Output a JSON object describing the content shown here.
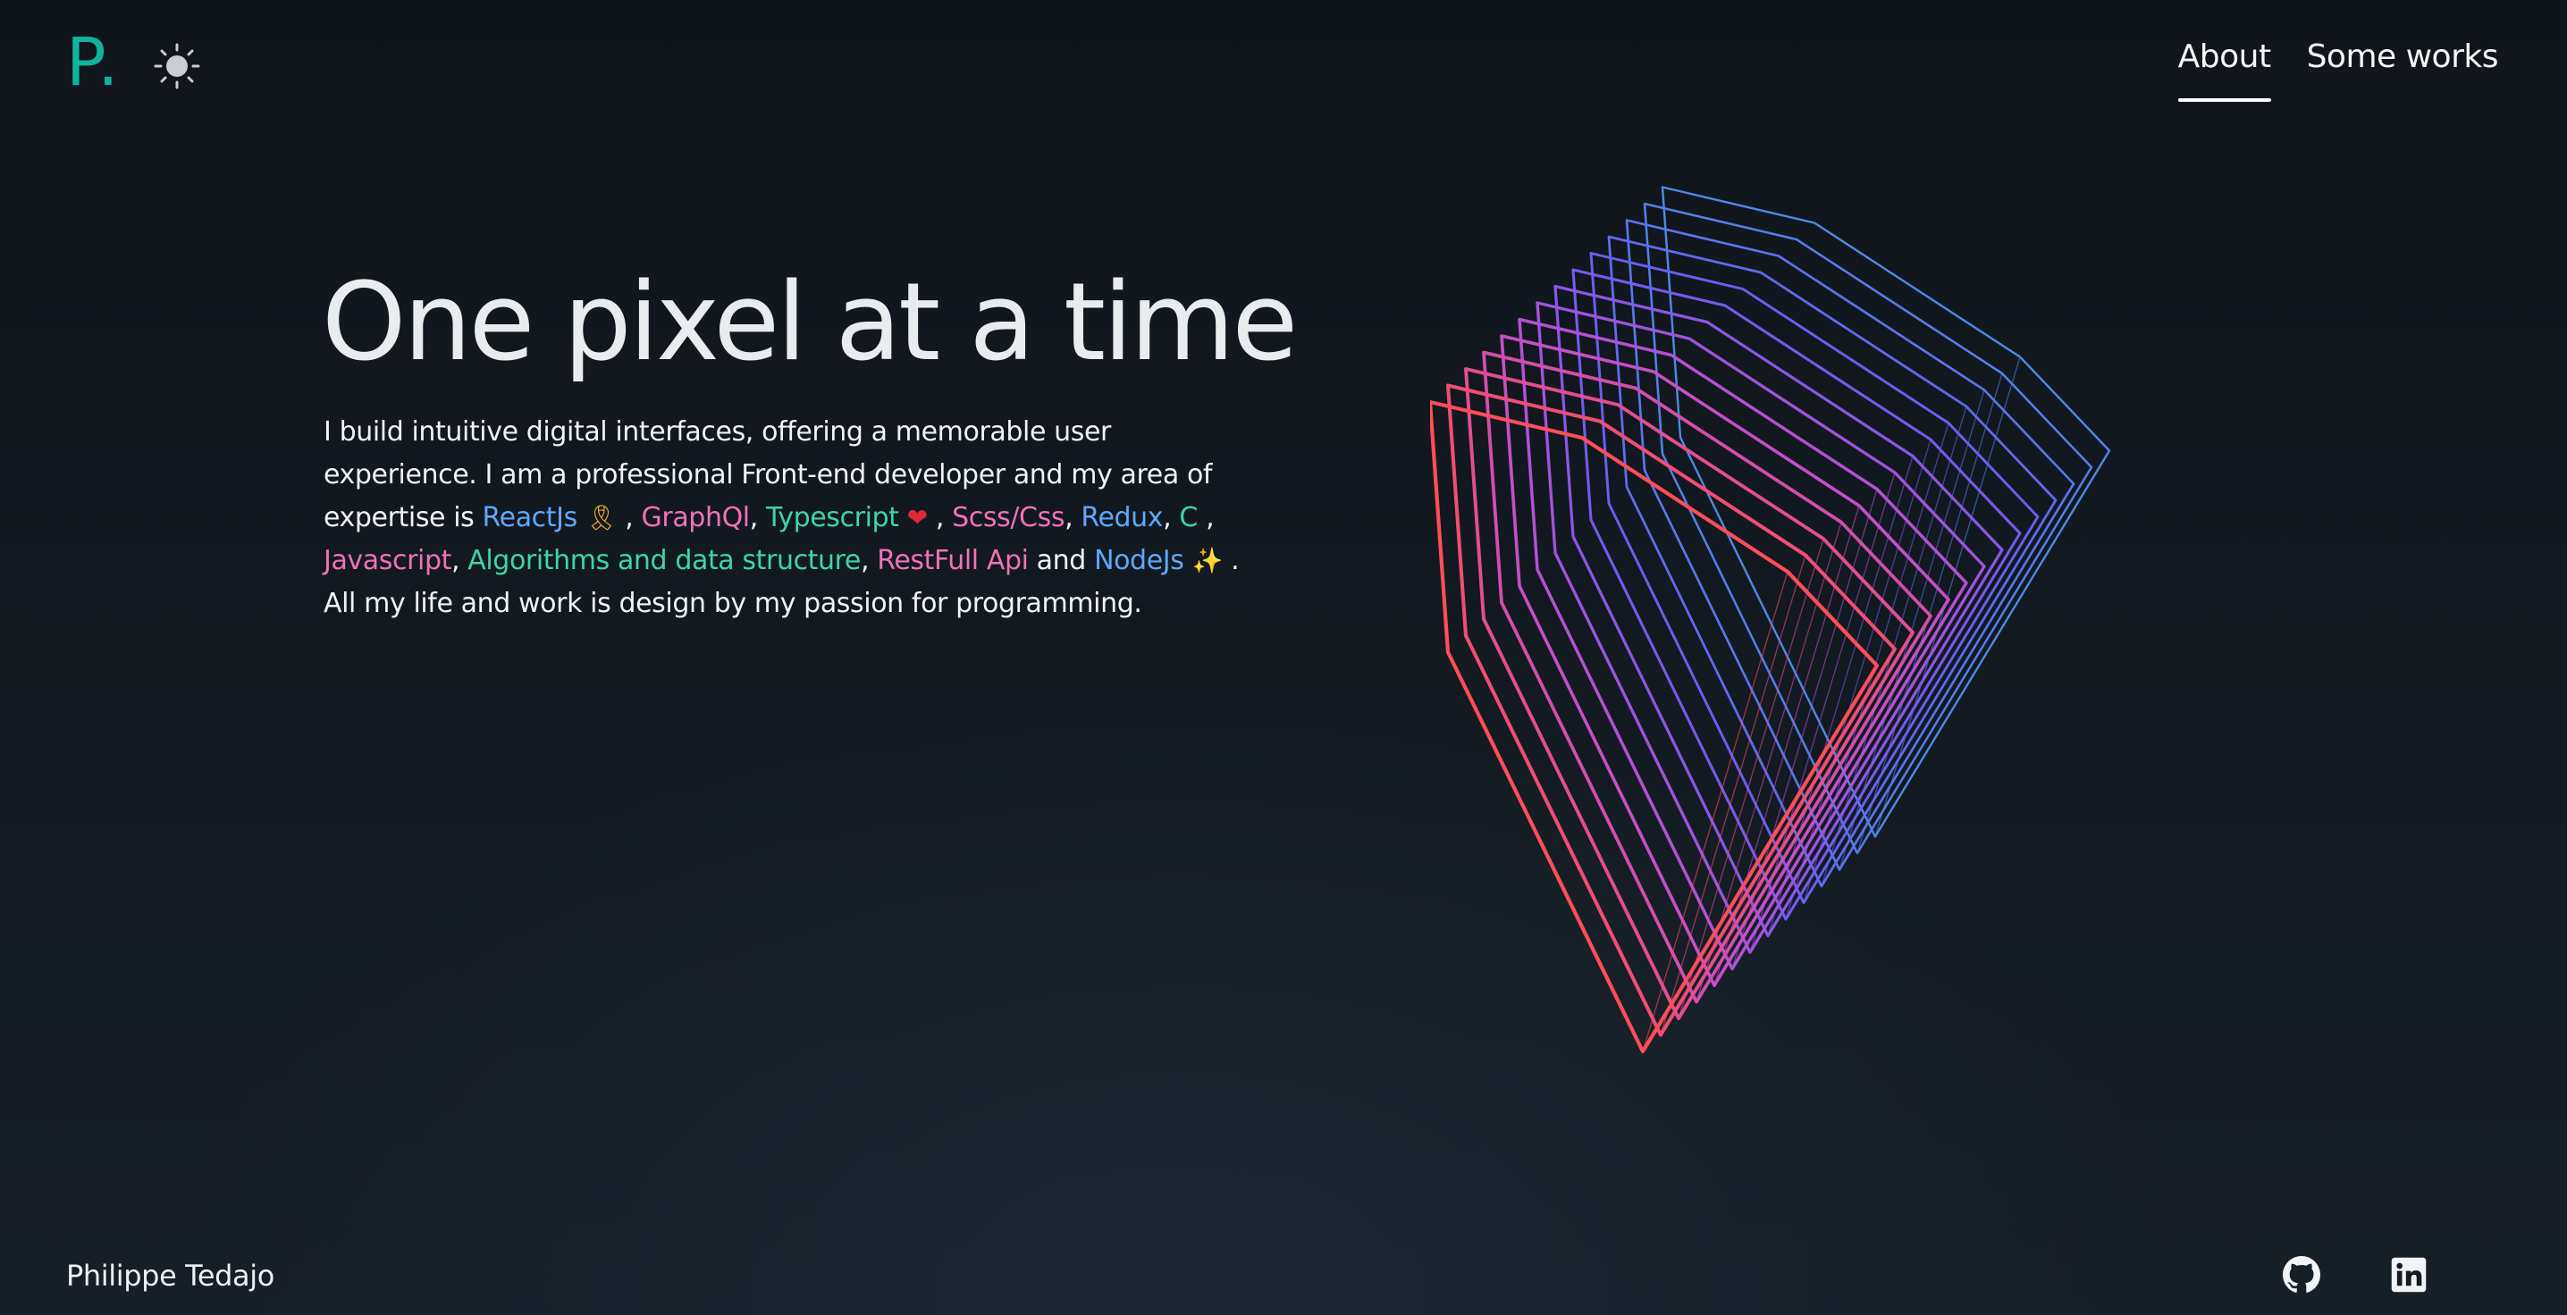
{
  "header": {
    "logo": "P.",
    "theme_icon": "sun-icon",
    "nav": [
      {
        "label": "About",
        "active": true
      },
      {
        "label": "Some works",
        "active": false
      }
    ]
  },
  "hero": {
    "title": "One pixel at a time",
    "text": {
      "t1": "I build intuitive digital interfaces, offering a memorable user experience. I am a professional Front-end developer and my area of expertise is ",
      "reactjs": "ReactJs",
      "ribbon": "🎗",
      "t2": " ,",
      "graphql": "GraphQl",
      "t3": ", ",
      "typescript": "Typescript",
      "heart": "❤",
      "t4": " , ",
      "scss": "Scss/Css",
      "t5": ", ",
      "redux": "Redux",
      "t6": ", ",
      "c": "C",
      "t7": " , ",
      "javascript": "Javascript",
      "t8": ", ",
      "algorithms": "Algorithms and data structure",
      "t9": ", ",
      "restfull": "RestFull Api",
      "t10": " and ",
      "nodejs": "NodeJs",
      "sparkles": "✨",
      "t11": " . All my life and work is design by my passion for programming."
    },
    "tech_colors": {
      "blue": "#5fa8ff",
      "pink": "#f072b6",
      "green": "#3fd6a4"
    }
  },
  "art": {
    "name": "gradient-wireframe-cube",
    "gradient": [
      "#ff4d5a",
      "#c04fd0",
      "#6a5cf2",
      "#4d8ae6"
    ]
  },
  "footer": {
    "name": "Philippe Tedajo",
    "social": [
      {
        "icon": "github-icon"
      },
      {
        "icon": "linkedin-icon"
      }
    ]
  },
  "colors": {
    "accent": "#12b39b",
    "background": "#131a21",
    "text": "#f1f3f5"
  }
}
